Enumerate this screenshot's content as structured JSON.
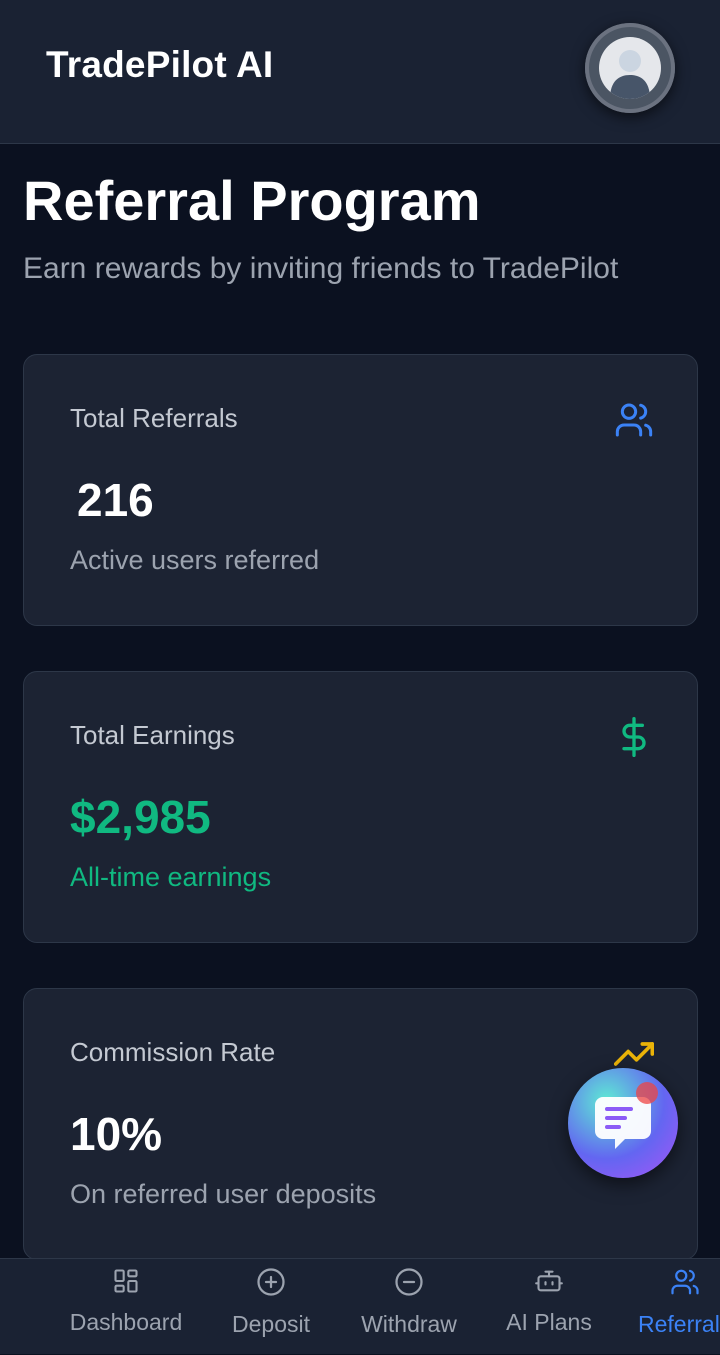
{
  "header": {
    "app_title": "TradePilot AI"
  },
  "page": {
    "title": "Referral Program",
    "subtitle": "Earn rewards by inviting friends to TradePilot"
  },
  "cards": {
    "referrals": {
      "label": "Total Referrals",
      "value": "216",
      "sub": "Active users referred",
      "icon": "users-icon",
      "accent": "#3b82f6"
    },
    "earnings": {
      "label": "Total Earnings",
      "value": "$2,985",
      "sub": "All-time earnings",
      "icon": "dollar-icon",
      "accent": "#10b981"
    },
    "commission": {
      "label": "Commission Rate",
      "value": "10%",
      "sub": "On referred user deposits",
      "icon": "trending-up-icon",
      "accent": "#eab308"
    }
  },
  "bottom_nav": {
    "items": [
      {
        "label": "Dashboard",
        "icon": "grid-icon"
      },
      {
        "label": "Deposit",
        "icon": "plus-circle-icon"
      },
      {
        "label": "Withdraw",
        "icon": "minus-circle-icon"
      },
      {
        "label": "AI Plans",
        "icon": "robot-icon"
      },
      {
        "label": "Referrals",
        "icon": "users-icon"
      }
    ],
    "active_index": 4
  },
  "colors": {
    "background": "#0b1120",
    "surface": "#1c2333",
    "active": "#3b82f6",
    "success": "#10b981"
  }
}
